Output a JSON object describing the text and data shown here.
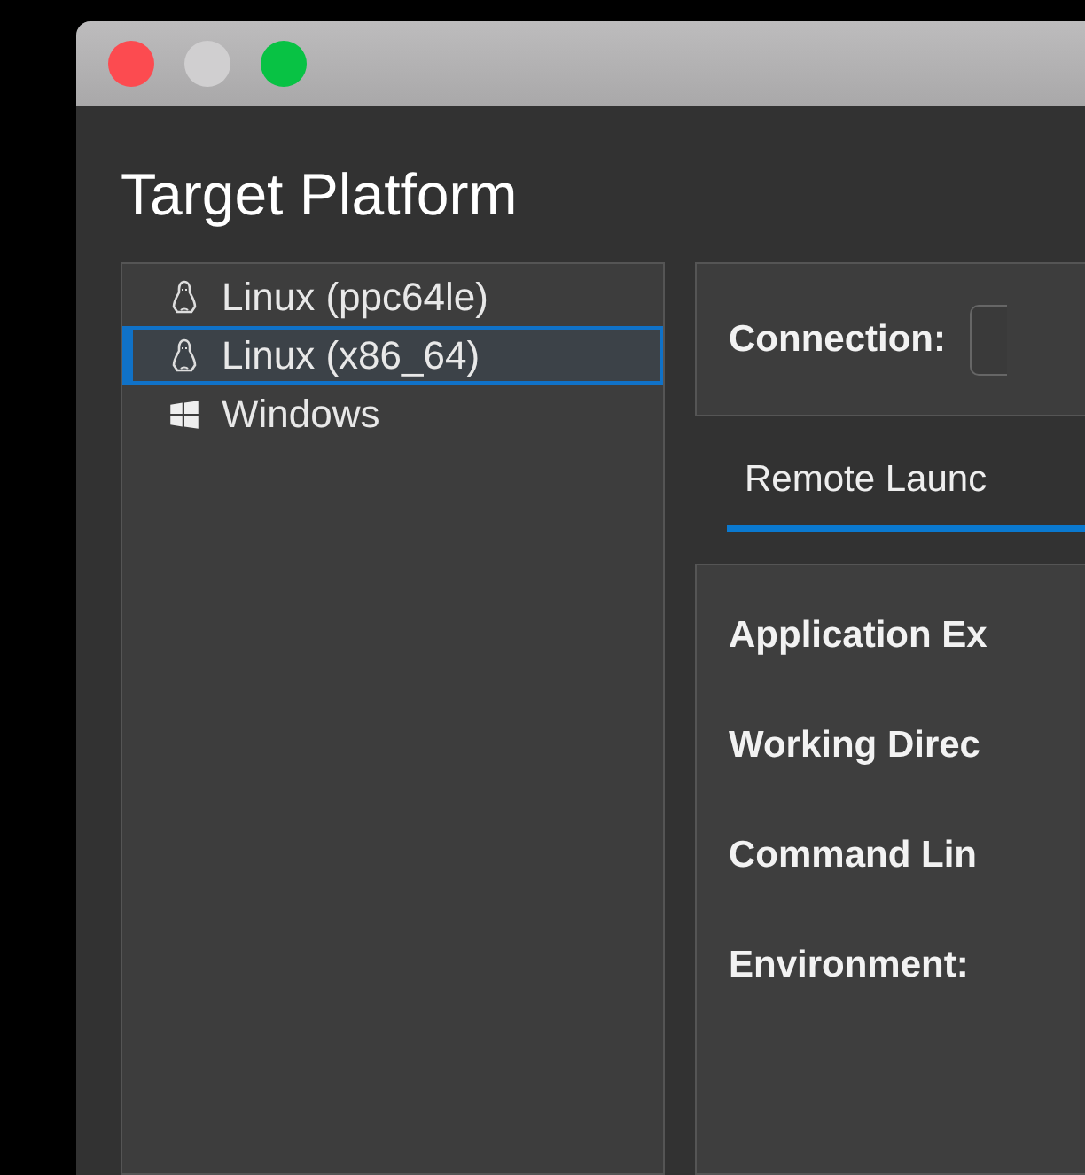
{
  "window": {
    "title": "Target Platform"
  },
  "platforms": [
    {
      "label": "Linux (ppc64le)",
      "kind": "linux",
      "selected": false
    },
    {
      "label": "Linux (x86_64)",
      "kind": "linux",
      "selected": true
    },
    {
      "label": "Windows",
      "kind": "windows",
      "selected": false
    }
  ],
  "connection": {
    "label": "Connection:"
  },
  "tabs": [
    {
      "label": "Remote Launc",
      "selected": true
    }
  ],
  "fields": [
    {
      "label": "Application Ex"
    },
    {
      "label": "Working Direc"
    },
    {
      "label": "Command Lin"
    },
    {
      "label": "Environment:"
    }
  ]
}
